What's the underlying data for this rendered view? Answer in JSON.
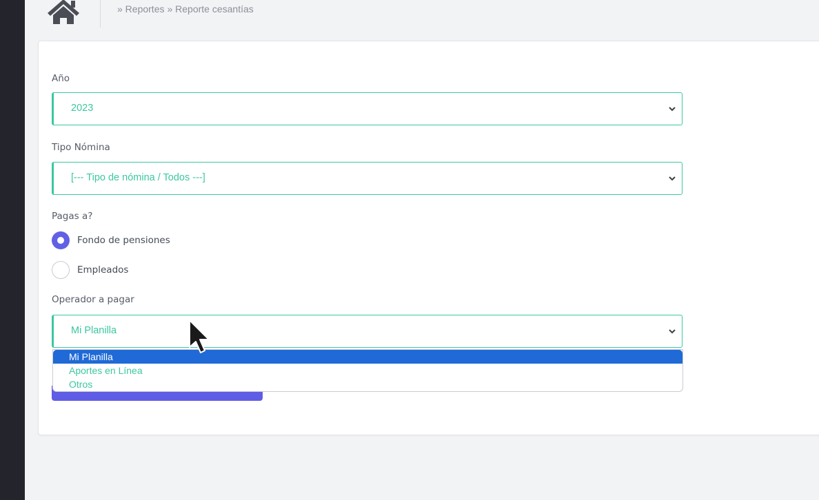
{
  "header": {
    "home_icon": "home-icon",
    "breadcrumb": [
      "» Reportes",
      "» Reporte cesantías"
    ]
  },
  "form": {
    "year": {
      "label": "Año",
      "value": "2023"
    },
    "payroll_type": {
      "label": "Tipo Nómina",
      "value": "[--- Tipo de nómina / Todos ---]"
    },
    "pay_to": {
      "label": "Pagas a?",
      "options": [
        {
          "label": "Fondo de pensiones",
          "checked": true
        },
        {
          "label": "Empleados",
          "checked": false
        }
      ]
    },
    "operator": {
      "label": "Operador a pagar",
      "value": "Mi Planilla",
      "options": [
        "Mi Planilla",
        "Aportes en Línea",
        "Otros"
      ],
      "highlighted": "Mi Planilla"
    }
  },
  "colors": {
    "accent": "#3cc7a0",
    "primary": "#5f5ce6",
    "option_highlight": "#1f6ad6",
    "sidebar": "#23242c"
  }
}
